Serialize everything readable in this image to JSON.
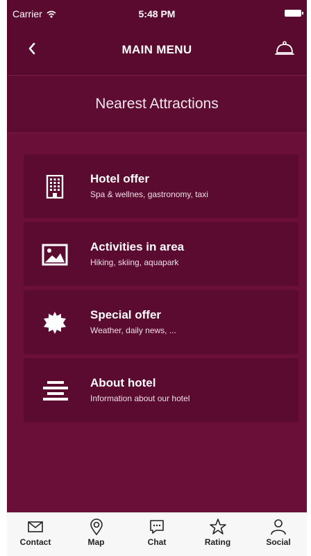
{
  "status_bar": {
    "carrier": "Carrier",
    "time": "5:48 PM"
  },
  "nav": {
    "title": "MAIN MENU"
  },
  "section": {
    "title": "Nearest Attractions"
  },
  "menu": [
    {
      "label": "Hotel offer",
      "sub": "Spa & wellnes, gastronomy, taxi",
      "icon": "building-icon"
    },
    {
      "label": "Activities in area",
      "sub": "Hiking, skiing, aquapark",
      "icon": "image-icon"
    },
    {
      "label": "Special offer",
      "sub": "Weather, daily news, ...",
      "icon": "badge-icon"
    },
    {
      "label": "About hotel",
      "sub": "Information about our hotel",
      "icon": "align-center-icon"
    }
  ],
  "tabs": [
    {
      "label": "Contact",
      "icon": "mail-icon"
    },
    {
      "label": "Map",
      "icon": "map-pin-icon"
    },
    {
      "label": "Chat",
      "icon": "chat-icon"
    },
    {
      "label": "Rating",
      "icon": "star-icon"
    },
    {
      "label": "Social",
      "icon": "user-icon"
    }
  ],
  "colors": {
    "background": "#6a0f37",
    "bar": "#5b0a2f",
    "card": "#5b0a30",
    "tab_bar": "#f7f7f7"
  }
}
